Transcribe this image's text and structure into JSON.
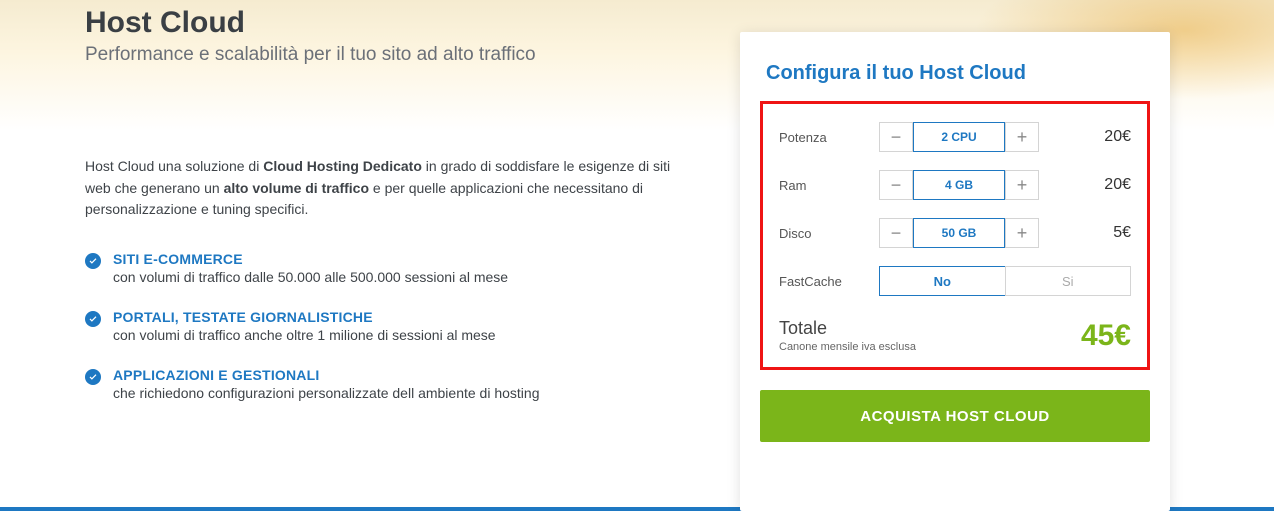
{
  "header": {
    "title": "Host Cloud",
    "subtitle": "Performance e scalabilità per il tuo sito ad alto traffico"
  },
  "description": {
    "p1a": "Host Cloud una soluzione di ",
    "p1b": "Cloud Hosting Dedicato",
    "p1c": " in grado di soddisfare le esigenze di siti web che generano un ",
    "p1d": "alto volume di traffico",
    "p1e": " e per quelle applicazioni che necessitano di personalizzazione e tuning specifici."
  },
  "bullets": [
    {
      "title": "SITI E-COMMERCE",
      "sub": "con volumi di traffico dalle 50.000 alle 500.000 sessioni al mese"
    },
    {
      "title": "PORTALI, TESTATE GIORNALISTICHE",
      "sub": "con volumi di traffico anche oltre 1 milione di sessioni al mese"
    },
    {
      "title": "APPLICAZIONI E GESTIONALI",
      "sub": "che richiedono configurazioni personalizzate dell ambiente di hosting"
    }
  ],
  "panel": {
    "title": "Configura il tuo Host Cloud",
    "rows": {
      "potenza": {
        "label": "Potenza",
        "value": "2 CPU",
        "price": "20€"
      },
      "ram": {
        "label": "Ram",
        "value": "4 GB",
        "price": "20€"
      },
      "disco": {
        "label": "Disco",
        "value": "50 GB",
        "price": "5€"
      },
      "fastcache": {
        "label": "FastCache",
        "opt_no": "No",
        "opt_si": "Si"
      }
    },
    "totale": {
      "label": "Totale",
      "sub": "Canone mensile iva esclusa",
      "value": "45€"
    },
    "cta": "ACQUISTA HOST CLOUD",
    "minus": "−",
    "plus": "+"
  }
}
